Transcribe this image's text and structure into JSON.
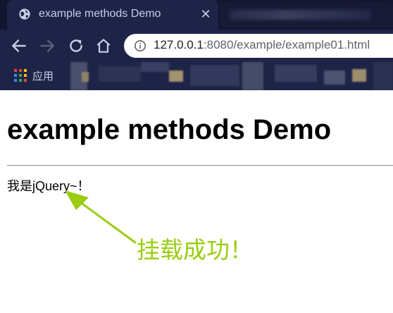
{
  "browser": {
    "tab_title": "example methods Demo",
    "tab_close_glyph": "✕",
    "favicon": "globe-icon",
    "url_host": "127.0.0.1",
    "url_rest": ":8080/example/example01.html",
    "bookmarks_apps_label": "应用"
  },
  "page": {
    "title": "example methods Demo",
    "message": "我是jQuery~！"
  },
  "annotation": {
    "text": "挂载成功！",
    "color": "#9acd11"
  },
  "colors": {
    "browser_frame": "#1e2447",
    "tab_strip": "#12162e",
    "page_background": "#ffffff"
  }
}
